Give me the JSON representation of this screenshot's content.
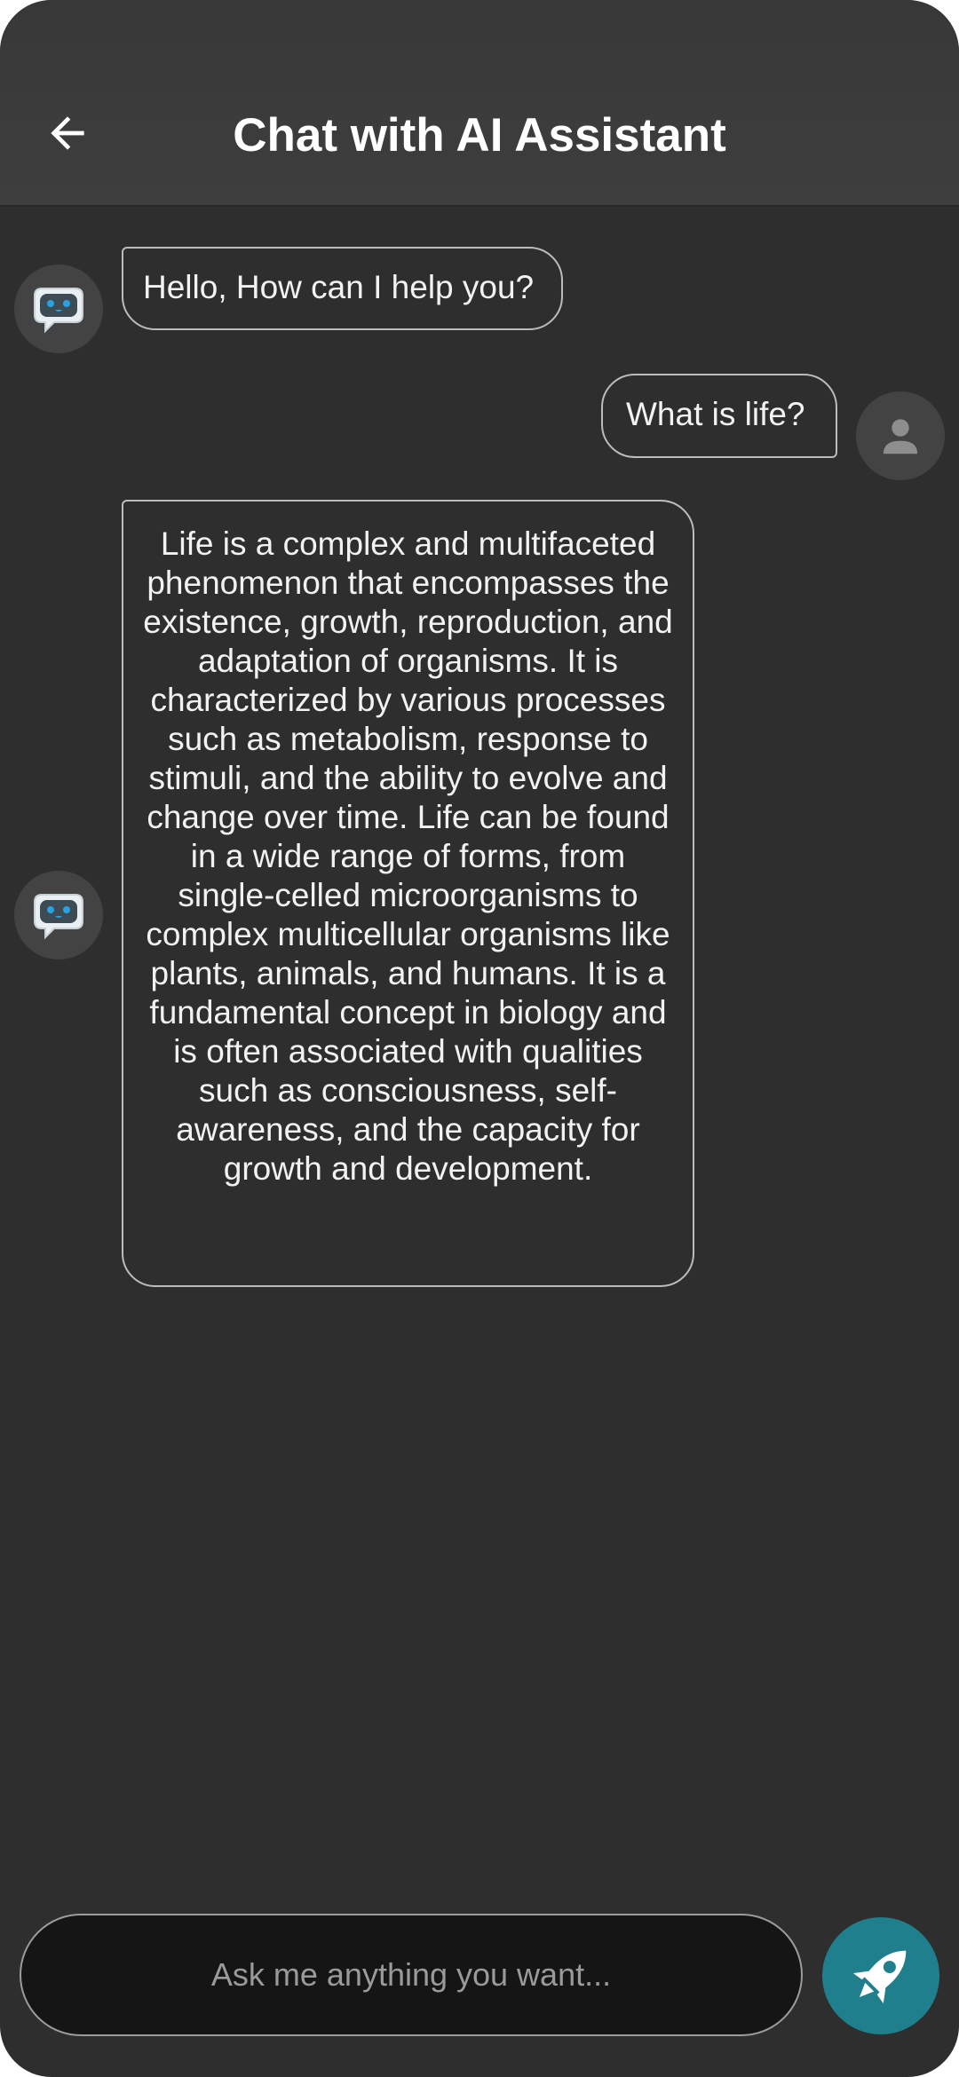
{
  "header": {
    "title": "Chat with AI Assistant",
    "back_icon": "arrow-left-icon"
  },
  "messages": [
    {
      "role": "assistant",
      "avatar_icon": "chat-robot-icon",
      "text": "Hello, How can I help you?"
    },
    {
      "role": "user",
      "avatar_icon": "person-icon",
      "text": "What is life?"
    },
    {
      "role": "assistant",
      "avatar_icon": "chat-robot-icon",
      "text": "Life is a complex and multifaceted phenomenon that encompasses the existence, growth, reproduction, and adaptation of organisms. It is characterized by various processes such as metabolism, response to stimuli, and the ability to evolve and change over time. Life can be found in a wide range of forms, from single-celled microorganisms to complex multicellular organisms like plants, animals, and humans. It is a fundamental concept in biology and is often associated with qualities such as consciousness, self-awareness, and the capacity for growth and development."
    }
  ],
  "composer": {
    "placeholder": "Ask me anything you want...",
    "value": "",
    "send_icon": "rocket-icon"
  },
  "colors": {
    "background": "#2e2e2e",
    "header": "#3c3c3c",
    "accent": "#1f7f8c",
    "robot_eyes": "#29a3e0",
    "bubble_border": "#bcbcbc"
  }
}
